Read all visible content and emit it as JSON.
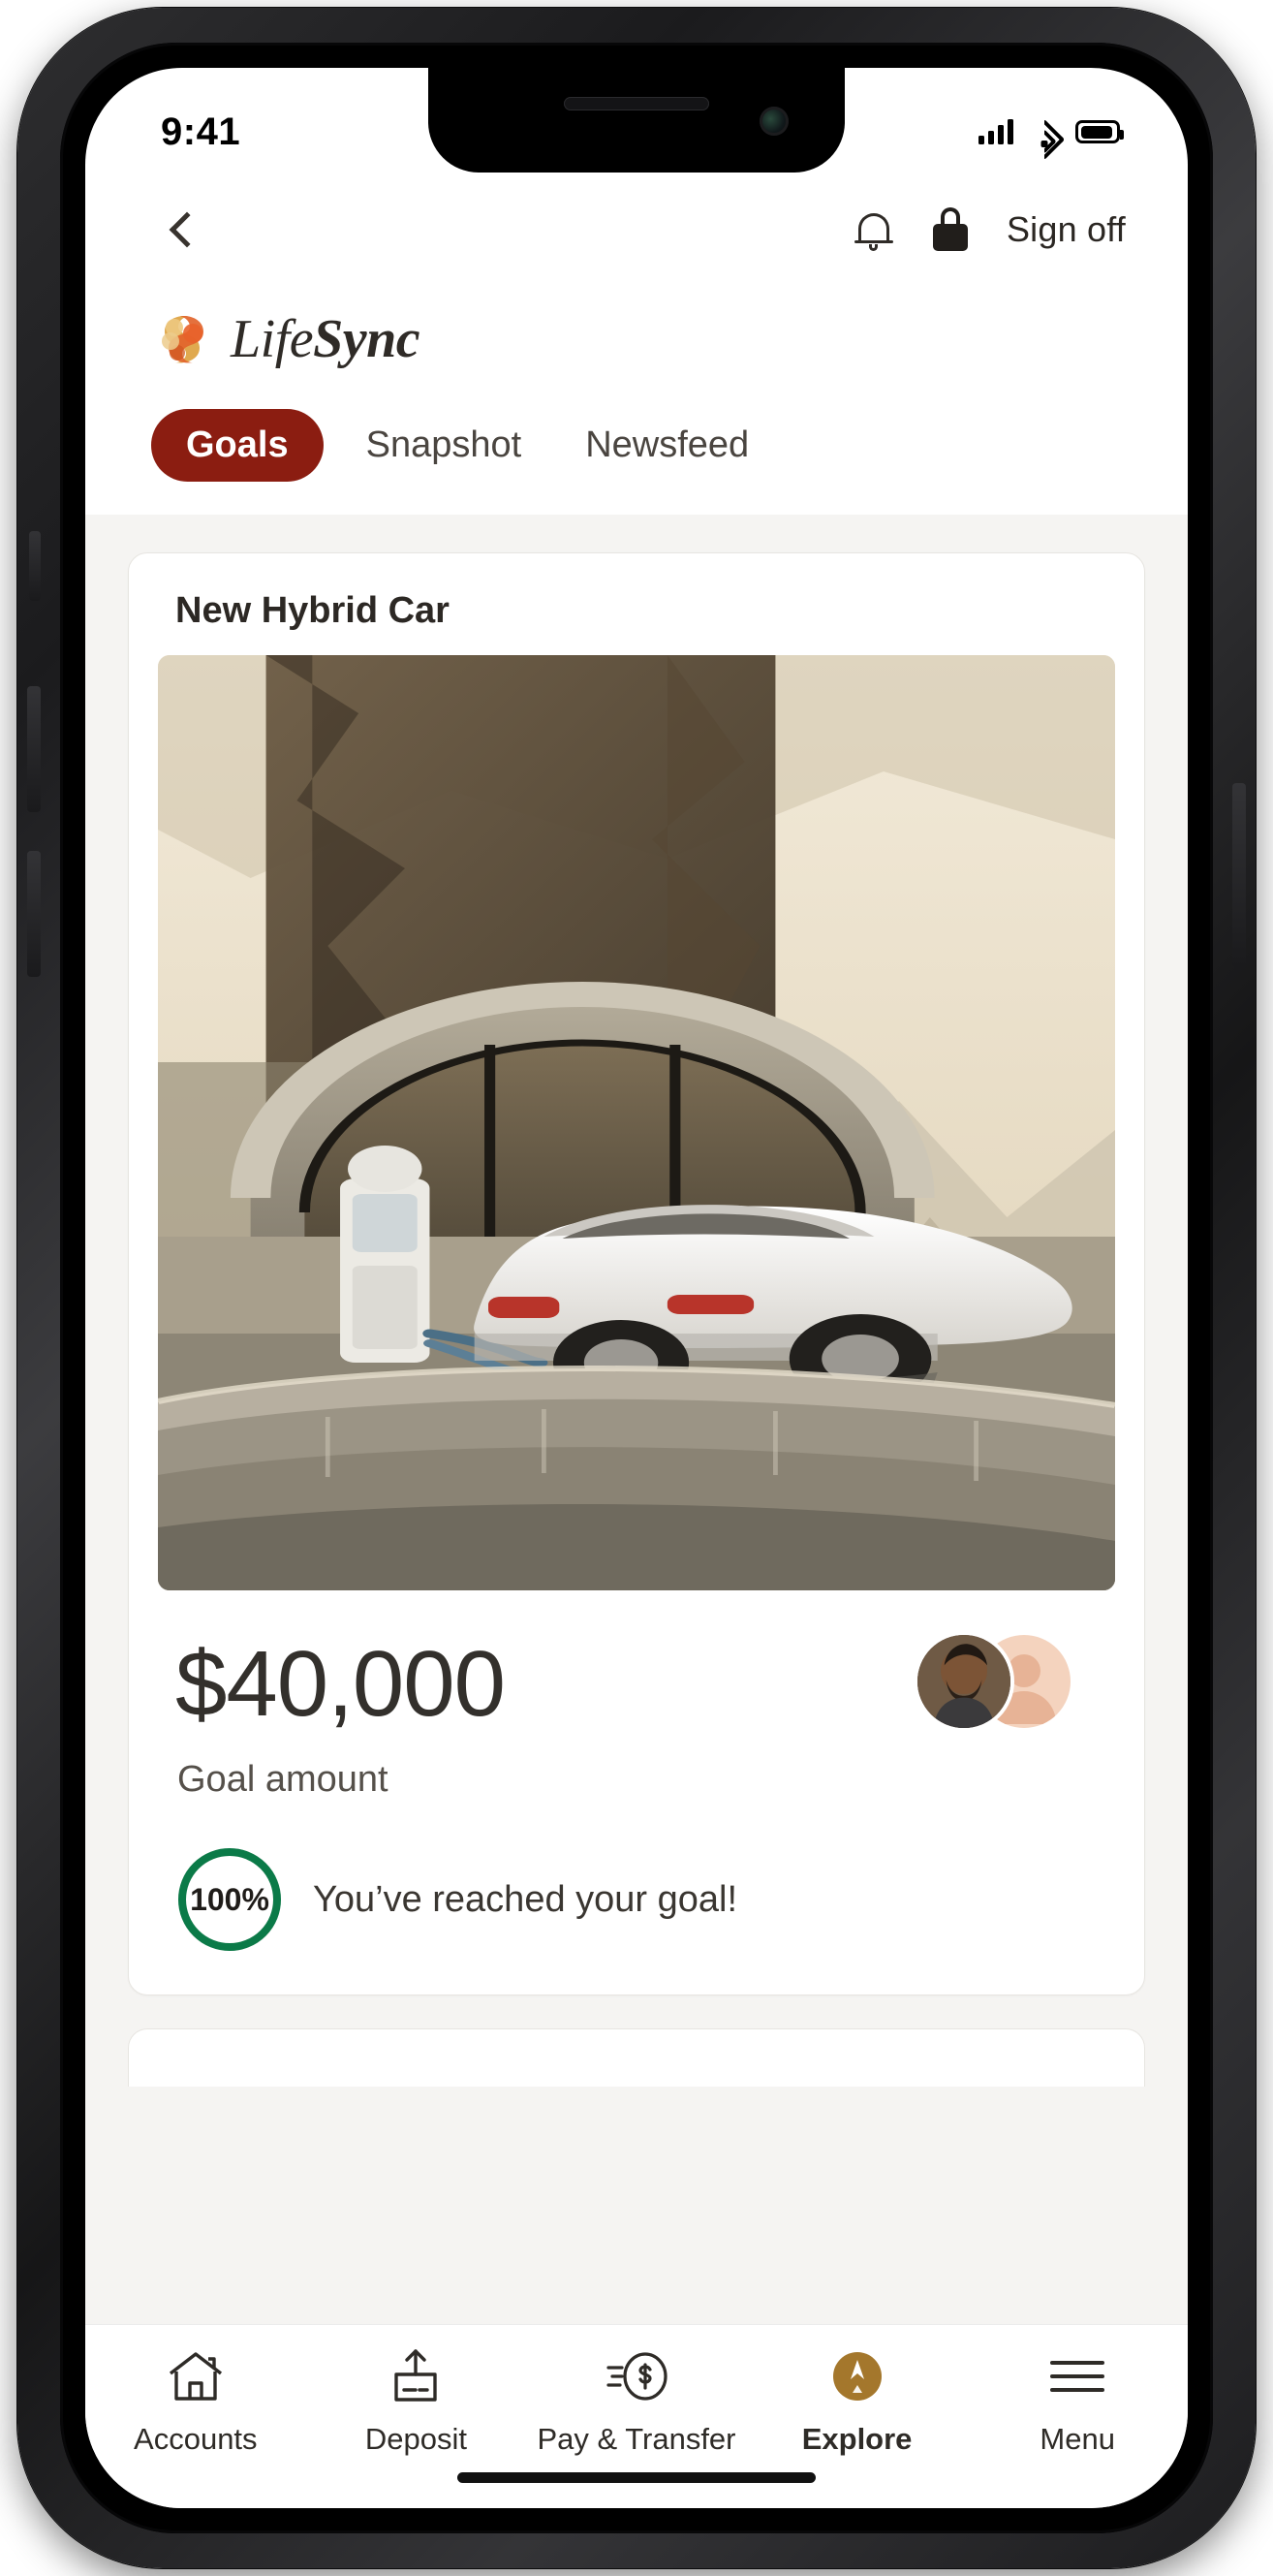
{
  "status_bar": {
    "time": "9:41",
    "icons": [
      "cellular-signal-icon",
      "wifi-icon",
      "battery-icon"
    ]
  },
  "header": {
    "back_icon": "chevron-left-icon",
    "bell_icon": "bell-icon",
    "lock_icon": "lock-icon",
    "sign_off_label": "Sign off",
    "brand_name_light": "Life",
    "brand_name_bold": "Sync",
    "brand_mark_icon": "lifesync-swirl-logo-icon"
  },
  "tabs": [
    {
      "label": "Goals",
      "active": true
    },
    {
      "label": "Snapshot",
      "active": false
    },
    {
      "label": "Newsfeed",
      "active": false
    }
  ],
  "goal_card": {
    "title": "New Hybrid Car",
    "hero_image_alt": "white hybrid sedan at an EV charging station in a mountain landscape",
    "amount": "$40,000",
    "amount_label": "Goal amount",
    "progress_percent": "100%",
    "progress_value": 100,
    "progress_message": "You’ve reached your goal!",
    "participants": [
      "avatar-photo",
      "avatar-placeholder"
    ]
  },
  "bottom_nav": [
    {
      "label": "Accounts",
      "icon": "house-icon",
      "active": false
    },
    {
      "label": "Deposit",
      "icon": "deposit-check-icon",
      "active": false
    },
    {
      "label": "Pay & Transfer",
      "icon": "dollar-circle-icon",
      "active": false
    },
    {
      "label": "Explore",
      "icon": "compass-icon",
      "active": true
    },
    {
      "label": "Menu",
      "icon": "hamburger-menu-icon",
      "active": false
    }
  ],
  "colors": {
    "accent_red": "#8b1d11",
    "progress_green": "#0b7a48",
    "explore_gold": "#a4772c",
    "text_dark": "#2c2824",
    "page_bg": "#f5f4f2"
  }
}
